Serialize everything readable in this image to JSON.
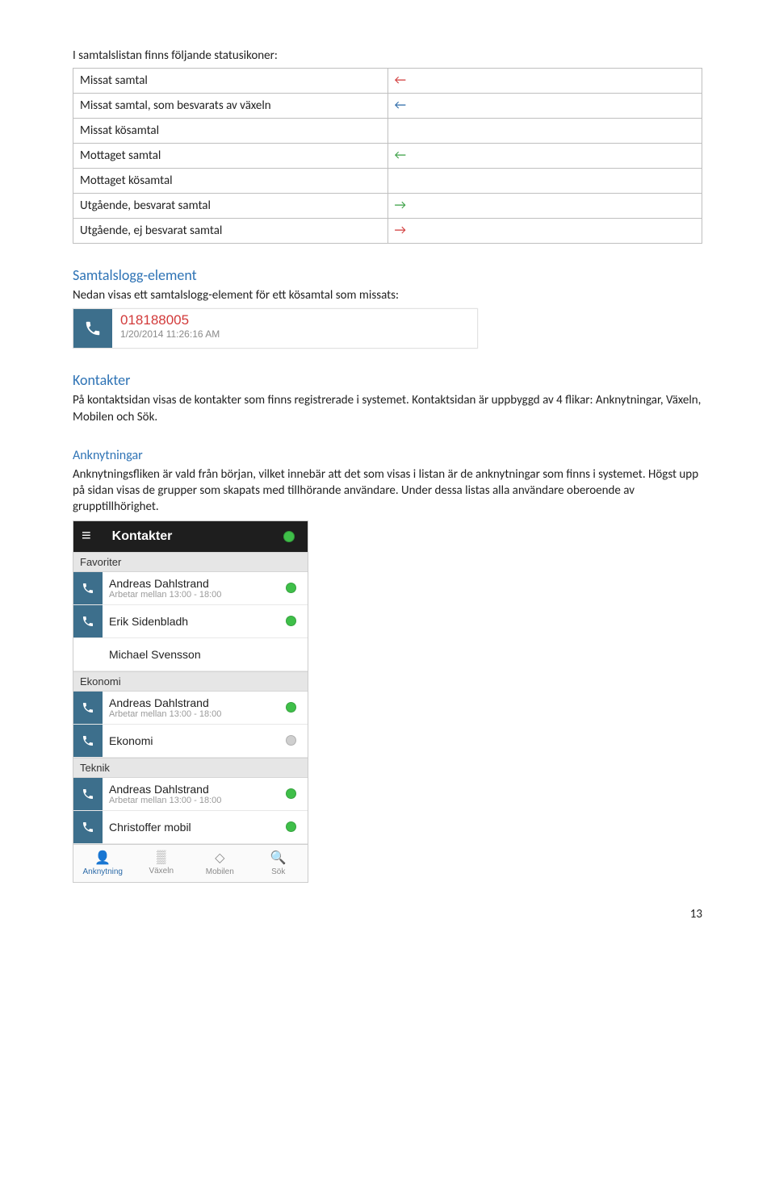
{
  "intro_line": "I samtalslistan finns följande statusikoner:",
  "status_rows": [
    {
      "label": "Missat samtal",
      "icon_color": "#d23a3a",
      "icon_glyph": "←",
      "type": "arrow"
    },
    {
      "label": "Missat samtal, som besvarats av växeln",
      "icon_color": "#2b6aa8",
      "icon_glyph": "←",
      "type": "arrow"
    },
    {
      "label": "Missat kösamtal",
      "icon_color": "#c83030",
      "type": "lines-red"
    },
    {
      "label": "Mottaget samtal",
      "icon_color": "#3aa044",
      "icon_glyph": "←",
      "type": "arrow"
    },
    {
      "label": "Mottaget kösamtal",
      "icon_color": "#3aa044",
      "type": "lines-green"
    },
    {
      "label": "Utgående, besvarat samtal",
      "icon_color": "#3aa044",
      "icon_glyph": "→",
      "type": "arrow"
    },
    {
      "label": "Utgående, ej besvarat samtal",
      "icon_color": "#d23a3a",
      "icon_glyph": "→",
      "type": "arrow"
    }
  ],
  "section_samtalslogg": {
    "heading": "Samtalslogg-element",
    "text": "Nedan visas ett samtalslogg-element för ett kösamtal som missats:"
  },
  "call_log": {
    "number": "018188005",
    "datetime": "1/20/2014 11:26:16 AM",
    "phone_glyph": "✆"
  },
  "section_kontakter": {
    "heading": "Kontakter",
    "para1": "På kontaktsidan visas de kontakter som finns registrerade i systemet. Kontaktsidan är uppbyggd av 4 flikar: Anknytningar, Växeln, Mobilen och Sök.",
    "sub_heading": "Anknytningar",
    "para2": "Anknytningsfliken är vald från början, vilket innebär att det som visas i listan är de anknytningar som finns i systemet. Högst upp på sidan visas de grupper som skapats med tillhörande användare. Under dessa listas alla användare oberoende av grupptillhörighet."
  },
  "phone": {
    "title": "Kontakter",
    "menu_glyph": "≡",
    "groups": [
      {
        "name": "Favoriter",
        "items": [
          {
            "name": "Andreas Dahlstrand",
            "sub": "Arbetar mellan 13:00 - 18:00",
            "dot": "green",
            "phone": true
          },
          {
            "name": "Erik Sidenbladh",
            "sub": "",
            "dot": "green",
            "phone": true
          },
          {
            "name": "Michael Svensson",
            "sub": "",
            "dot": "",
            "phone": false
          }
        ]
      },
      {
        "name": "Ekonomi",
        "items": [
          {
            "name": "Andreas Dahlstrand",
            "sub": "Arbetar mellan 13:00 - 18:00",
            "dot": "green",
            "phone": true
          },
          {
            "name": "Ekonomi",
            "sub": "",
            "dot": "gray",
            "phone": true
          }
        ]
      },
      {
        "name": "Teknik",
        "items": [
          {
            "name": "Andreas Dahlstrand",
            "sub": "Arbetar mellan 13:00 - 18:00",
            "dot": "green",
            "phone": true
          },
          {
            "name": "Christoffer mobil",
            "sub": "",
            "dot": "green",
            "phone": true
          }
        ]
      }
    ],
    "tabs": [
      {
        "label": "Anknytning",
        "glyph": "👤",
        "active": true
      },
      {
        "label": "Växeln",
        "glyph": "▒",
        "active": false
      },
      {
        "label": "Mobilen",
        "glyph": "◇",
        "active": false
      },
      {
        "label": "Sök",
        "glyph": "🔍",
        "active": false
      }
    ]
  },
  "page_number": "13"
}
